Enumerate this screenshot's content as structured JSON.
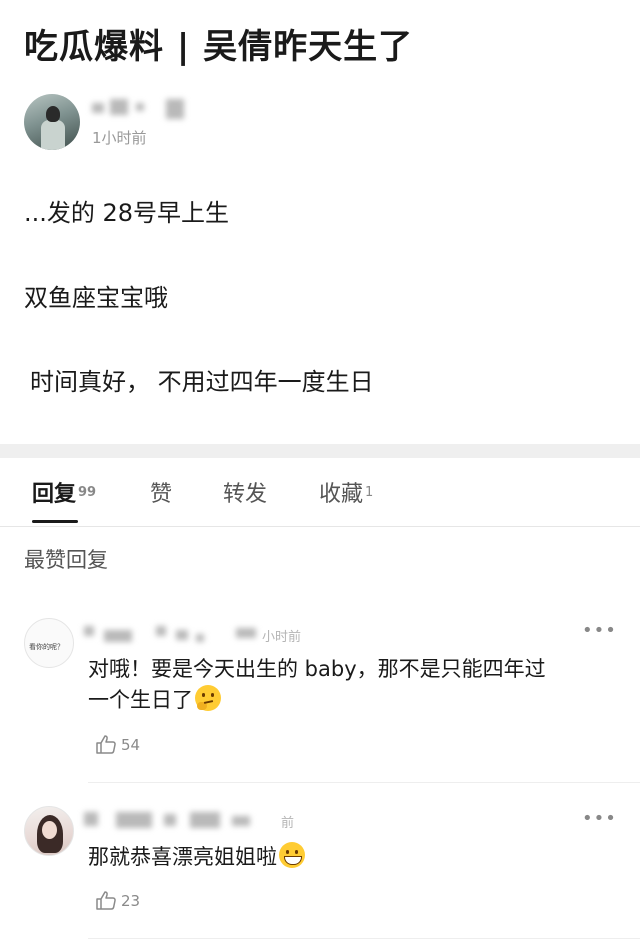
{
  "post": {
    "title": "吃瓜爆料 | 吴倩昨天生了",
    "time": "1小时前",
    "paragraphs": [
      "...发的 28号早上生",
      "双鱼座宝宝哦",
      "时间真好，  不用过四年一度生日"
    ]
  },
  "tabs": [
    {
      "label": "回复",
      "count": "99"
    },
    {
      "label": "赞",
      "count": ""
    },
    {
      "label": "转发",
      "count": ""
    },
    {
      "label": "收藏",
      "count": "1"
    }
  ],
  "section_title": "最赞回复",
  "comments": [
    {
      "avatar_text": "看你的呢？",
      "time_fragment": "小时前",
      "line1": "对哦！要是今天出生的 baby，那不是只能四年过",
      "line2": "一个生日了",
      "emoji": "thinking-face-icon",
      "likes": "54"
    },
    {
      "time_fragment": "前",
      "text": "那就恭喜漂亮姐姐啦",
      "emoji": "grinning-face-icon",
      "likes": "23"
    }
  ],
  "colors": {
    "divider_band": "#efefef",
    "muted_text": "#999999",
    "emoji_yellow": "#ffcc33"
  }
}
